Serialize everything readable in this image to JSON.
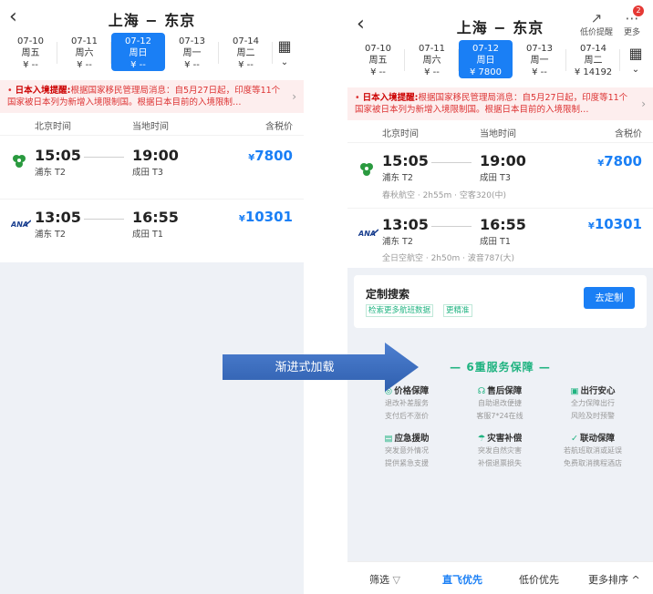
{
  "left": {
    "title": "上海 − 东京",
    "dates": [
      {
        "d": "07-10",
        "w": "周五",
        "p": "¥ --"
      },
      {
        "d": "07-11",
        "w": "周六",
        "p": "¥ --"
      },
      {
        "d": "07-12",
        "w": "周日",
        "p": "¥ --"
      },
      {
        "d": "07-13",
        "w": "周一",
        "p": "¥ --"
      },
      {
        "d": "07-14",
        "w": "周二",
        "p": "¥ --"
      }
    ],
    "notice_bold": "日本入境提醒:",
    "notice_text": "根据国家移民管理局消息：自5月27日起，印度等11个国家被日本列为新增入境限制国。根据日本目前的入境限制…",
    "head": {
      "beijing": "北京时间",
      "local": "当地时间",
      "price": "含税价"
    },
    "flights": [
      {
        "dep": "15:05",
        "dep_ap": "浦东 T2",
        "arr": "19:00",
        "arr_ap": "成田 T3",
        "price": "7800",
        "currency": "¥"
      },
      {
        "dep": "13:05",
        "dep_ap": "浦东 T2",
        "arr": "16:55",
        "arr_ap": "成田 T1",
        "price": "10301",
        "currency": "¥"
      }
    ]
  },
  "right": {
    "title": "上海 − 东京",
    "tool_price_alert": "低价提醒",
    "tool_more": "更多",
    "badge": "2",
    "dates": [
      {
        "d": "07-10",
        "w": "周五",
        "p": "¥ --"
      },
      {
        "d": "07-11",
        "w": "周六",
        "p": "¥ --"
      },
      {
        "d": "07-12",
        "w": "周日",
        "p": "¥ 7800"
      },
      {
        "d": "07-13",
        "w": "周一",
        "p": "¥ --"
      },
      {
        "d": "07-14",
        "w": "周二",
        "p": "¥ 14192"
      }
    ],
    "notice_bold": "日本入境提醒:",
    "notice_text": "根据国家移民管理局消息：自5月27日起，印度等11个国家被日本列为新增入境限制国。根据日本目前的入境限制…",
    "head": {
      "beijing": "北京时间",
      "local": "当地时间",
      "price": "含税价"
    },
    "flights": [
      {
        "dep": "15:05",
        "dep_ap": "浦东 T2",
        "arr": "19:00",
        "arr_ap": "成田 T3",
        "price": "7800",
        "currency": "¥",
        "sub": "春秋航空 · 2h55m · 空客320(中)"
      },
      {
        "dep": "13:05",
        "dep_ap": "浦东 T2",
        "arr": "16:55",
        "arr_ap": "成田 T1",
        "price": "10301",
        "currency": "¥",
        "sub": "全日空航空 · 2h50m · 波音787(大)"
      }
    ],
    "custom": {
      "title": "定制搜索",
      "tag1": "检索更多航班数据",
      "tag2": "更精准",
      "button": "去定制"
    },
    "services_title": "6重服务保障",
    "services": [
      {
        "h": "价格保障",
        "d1": "退改补差服务",
        "d2": "支付后不涨价"
      },
      {
        "h": "售后保障",
        "d1": "自助退改便捷",
        "d2": "客服7*24在线"
      },
      {
        "h": "出行安心",
        "d1": "全力保障出行",
        "d2": "风险及时预警"
      },
      {
        "h": "应急援助",
        "d1": "突发意外情况",
        "d2": "提供紧急支援"
      },
      {
        "h": "灾害补偿",
        "d1": "突发自然灾害",
        "d2": "补偿退票损失"
      },
      {
        "h": "联动保障",
        "d1": "若航班取消或延误",
        "d2": "免费取消携程酒店"
      }
    ],
    "bottom": {
      "filter": "筛选",
      "direct": "直飞优先",
      "low": "低价优先",
      "more": "更多排序"
    }
  },
  "arrow_label": "渐进式加载",
  "colors": {
    "accent": "#1a7ff5",
    "green": "#1fb380",
    "notice": "#d33"
  }
}
